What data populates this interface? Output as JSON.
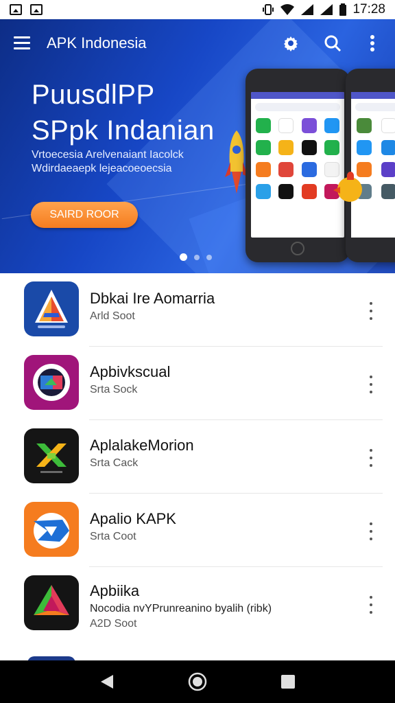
{
  "status_bar": {
    "time": "17:28",
    "icons": [
      "image-notification-icon",
      "alert-notification-icon",
      "vibrate-icon",
      "wifi-icon",
      "signal-icon",
      "signal-icon-2",
      "battery-icon"
    ]
  },
  "app_bar": {
    "title": "APK Indonesia",
    "icons": [
      "menu-icon",
      "settings-icon",
      "search-icon",
      "more-vert-icon"
    ]
  },
  "banner": {
    "title_line1": "PuusdlPP",
    "title_line2": "SPpk Indanian",
    "subtitle_line1": "Vrtoecesia Arelvenaiant Iacolck",
    "subtitle_line2": "Wdirdaeaepk lejeacoeoecsia",
    "cta_label": "SAIRD ROOR",
    "carousel_dots": 3,
    "carousel_active_index": 0,
    "colors": {
      "banner": "#1747c6",
      "cta": "#f5862a"
    }
  },
  "apps": [
    {
      "title": "Dbkai Ire Aomarria",
      "subtitle": "Arld Soot",
      "icon": "app-icon-triangle-a"
    },
    {
      "title": "Apbivkscual",
      "subtitle": "Srta Sock",
      "icon": "app-icon-pg-logo"
    },
    {
      "title": "AplalakeMorion",
      "subtitle": "Srta Cack",
      "icon": "app-icon-x-cross"
    },
    {
      "title": "Apalio KAPK",
      "subtitle": "Srta Coot",
      "icon": "app-icon-blue-fish"
    },
    {
      "title": "Apbiika",
      "description": "Nocodia nvYPrunreanino byalih (ribk)",
      "subtitle": "A2D Soot",
      "icon": "app-icon-pyramid"
    }
  ],
  "nav_bar": {
    "icons": [
      "back-icon",
      "home-icon",
      "recents-icon"
    ]
  }
}
